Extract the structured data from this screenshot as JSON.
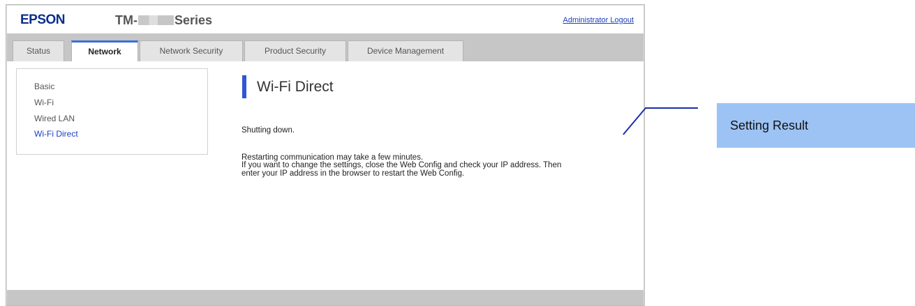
{
  "header": {
    "logo": "EPSON",
    "model_prefix": "TM-",
    "model_suffix": "Series",
    "logout_link": "Administrator Logout"
  },
  "tabs": [
    {
      "label": "Status",
      "active": false
    },
    {
      "label": "Network",
      "active": true
    },
    {
      "label": "Network Security",
      "active": false
    },
    {
      "label": "Product Security",
      "active": false
    },
    {
      "label": "Device Management",
      "active": false
    }
  ],
  "sidebar": {
    "items": [
      {
        "label": "Basic",
        "selected": false
      },
      {
        "label": "Wi-Fi",
        "selected": false
      },
      {
        "label": "Wired LAN",
        "selected": false
      },
      {
        "label": "Wi-Fi Direct",
        "selected": true
      }
    ]
  },
  "main": {
    "title": "Wi-Fi Direct",
    "status": "Shutting down.",
    "message_lines": [
      "Restarting communication may take a few minutes.",
      "If you want to change the settings, close the Web Config and check your IP address. Then",
      "enter your IP address in the browser to restart the Web Config."
    ]
  },
  "callout": {
    "label": "Setting Result"
  },
  "colors": {
    "brand": "#0b2f8a",
    "accent": "#2e57d4",
    "link": "#1a3fbf",
    "callout_bg": "#9dc3f4"
  }
}
